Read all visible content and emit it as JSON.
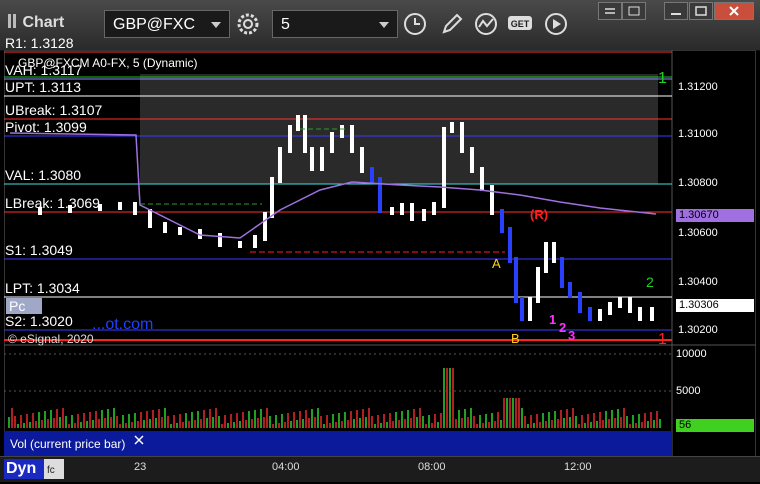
{
  "window": {
    "title": "Chart"
  },
  "toolbar": {
    "symbol": "GBP@FXC",
    "interval": "5",
    "get_label": "GET"
  },
  "chart": {
    "study_title": "GBP@FXCM A0-FX, 5 (Dynamic)",
    "copyright": "© eSignal, 2020",
    "watermark": "...ot.com",
    "pc_label": "Pc",
    "levels": [
      {
        "label": "R1: 1.3128",
        "color": "#ff3030"
      },
      {
        "label": "VAH: 1.3117",
        "color": "#8a8aff"
      },
      {
        "label": "UPT: 1.3113",
        "color": "#ffffff"
      },
      {
        "label": "UBreak: 1.3107",
        "color": "#ff3030"
      },
      {
        "label": "Pivot: 1.3099",
        "color": "#3b3bff"
      },
      {
        "label": "VAL: 1.3080",
        "color": "#40e0e0"
      },
      {
        "label": "LBreak: 1.3069",
        "color": "#ff3030"
      },
      {
        "label": "S1: 1.3049",
        "color": "#3b3bff"
      },
      {
        "label": "LPT: 1.3034",
        "color": "#ffffff"
      },
      {
        "label": "S2: 1.3020",
        "color": "#3b3bff"
      }
    ],
    "price_axis": [
      "1.31200",
      "1.31000",
      "1.30800",
      "1.30600",
      "1.30400",
      "1.30200"
    ],
    "price_tags": [
      {
        "value": "1.30670",
        "bg": "#a070e0",
        "fg": "#000000"
      },
      {
        "value": "1.30306",
        "bg": "#ffffff",
        "fg": "#000000"
      }
    ],
    "markers": {
      "one_top": "1",
      "one_bottom": "1",
      "two": "2",
      "a": "A",
      "b": "B",
      "r": "(R)",
      "seq": [
        "1",
        "2",
        "3"
      ]
    }
  },
  "volume": {
    "label": "Vol (current price bar)",
    "axis": [
      "10000",
      "5000"
    ],
    "current_value": "56"
  },
  "time_axis": {
    "labels": [
      "23",
      "04:00",
      "08:00",
      "12:00"
    ]
  },
  "bottom": {
    "mode": "Dyn"
  }
}
